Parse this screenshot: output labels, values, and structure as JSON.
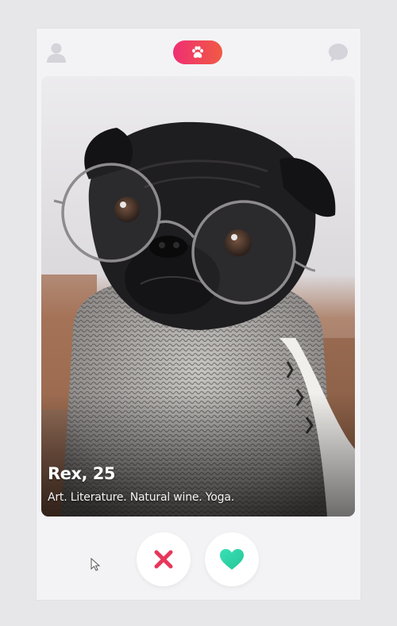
{
  "header": {
    "left_icon": "user-icon",
    "center_icon": "paw-icon",
    "right_icon": "chat-icon",
    "accent_gradient": [
      "#ef2f72",
      "#f05a44"
    ],
    "icon_color": "#d4d4da"
  },
  "card": {
    "name": "Rex, 25",
    "bio": "Art. Literature. Natural wine. Yoga.",
    "photo_subject": "black pug wearing round glasses and a knitted scarf"
  },
  "actions": {
    "dislike_icon": "close-icon",
    "dislike_color": "#e8365b",
    "like_icon": "heart-icon",
    "like_color": "#2fd6a8"
  }
}
